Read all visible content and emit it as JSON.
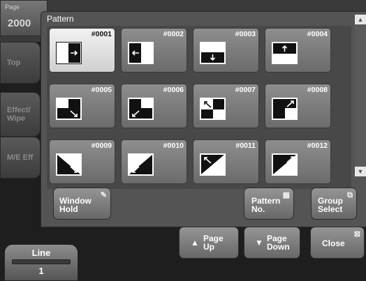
{
  "background": {
    "page_label": "Page",
    "page_value": "2000",
    "tabs": [
      "Top",
      "Effect/\nWipe",
      "M/E Eff"
    ],
    "line_label": "Line",
    "line_value": "1"
  },
  "window": {
    "title": "Pattern",
    "patterns": [
      {
        "id": "#0001",
        "icon": "wipe-right-icon",
        "selected": true
      },
      {
        "id": "#0002",
        "icon": "wipe-left-icon",
        "selected": false
      },
      {
        "id": "#0003",
        "icon": "wipe-down-icon",
        "selected": false
      },
      {
        "id": "#0004",
        "icon": "wipe-up-icon",
        "selected": false
      },
      {
        "id": "#0005",
        "icon": "wipe-diag-down-right-icon",
        "selected": false
      },
      {
        "id": "#0006",
        "icon": "wipe-diag-down-left-icon",
        "selected": false
      },
      {
        "id": "#0007",
        "icon": "wipe-diag-up-left-icon",
        "selected": false
      },
      {
        "id": "#0008",
        "icon": "wipe-diag-up-right-icon",
        "selected": false
      },
      {
        "id": "#0009",
        "icon": "wipe-triangle-down-right-icon",
        "selected": false
      },
      {
        "id": "#0010",
        "icon": "wipe-triangle-down-left-icon",
        "selected": false
      },
      {
        "id": "#0011",
        "icon": "wipe-triangle-up-left-icon",
        "selected": false
      },
      {
        "id": "#0012",
        "icon": "wipe-triangle-up-right-icon",
        "selected": false
      }
    ],
    "buttons": {
      "window_hold": "Window\nHold",
      "pattern_no": "Pattern\nNo.",
      "group_select": "Group\nSelect",
      "page_up": "Page\nUp",
      "page_down": "Page\nDown",
      "close": "Close"
    }
  }
}
